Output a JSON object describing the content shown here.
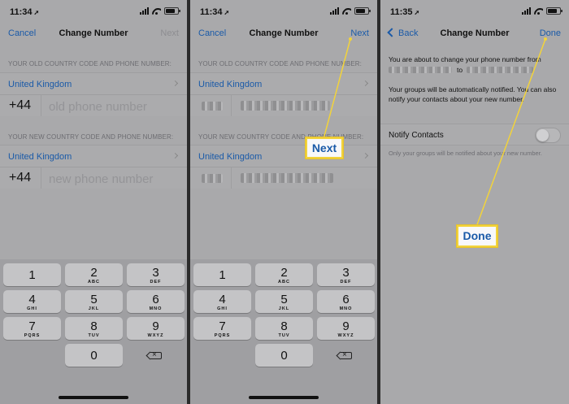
{
  "status": {
    "time1": "11:34",
    "time2": "11:34",
    "time3": "11:35"
  },
  "screen1": {
    "nav": {
      "cancel": "Cancel",
      "title": "Change Number",
      "next": "Next"
    },
    "old_label": "YOUR OLD COUNTRY CODE AND PHONE NUMBER:",
    "old_country": "United Kingdom",
    "old_code": "+44",
    "old_placeholder": "old phone number",
    "new_label": "YOUR NEW COUNTRY CODE AND PHONE NUMBER:",
    "new_country": "United Kingdom",
    "new_code": "+44",
    "new_placeholder": "new phone number"
  },
  "screen2": {
    "nav": {
      "cancel": "Cancel",
      "title": "Change Number",
      "next": "Next"
    },
    "old_label": "YOUR OLD COUNTRY CODE AND PHONE NUMBER:",
    "old_country": "United Kingdom",
    "new_label": "YOUR NEW COUNTRY CODE AND PHONE NUMBER:",
    "new_country": "United Kingdom"
  },
  "screen3": {
    "nav": {
      "back": "Back",
      "title": "Change Number",
      "done": "Done"
    },
    "msg1_a": "You are about to change your phone number from",
    "msg1_to": "to",
    "msg2": "Your groups will be automatically notified. You can also notify your contacts about your new number.",
    "notify_label": "Notify Contacts",
    "notify_on": false,
    "note": "Only your groups will be notified about your new number."
  },
  "keypad": {
    "keys": [
      {
        "num": "1",
        "letters": ""
      },
      {
        "num": "2",
        "letters": "ABC"
      },
      {
        "num": "3",
        "letters": "DEF"
      },
      {
        "num": "4",
        "letters": "GHI"
      },
      {
        "num": "5",
        "letters": "JKL"
      },
      {
        "num": "6",
        "letters": "MNO"
      },
      {
        "num": "7",
        "letters": "PQRS"
      },
      {
        "num": "8",
        "letters": "TUV"
      },
      {
        "num": "9",
        "letters": "WXYZ"
      },
      {
        "num": "0",
        "letters": ""
      }
    ]
  },
  "callouts": {
    "next": "Next",
    "done": "Done"
  },
  "colors": {
    "accent": "#1a5aa8",
    "highlight": "#f2d33b",
    "background": "#a9a9ab"
  }
}
